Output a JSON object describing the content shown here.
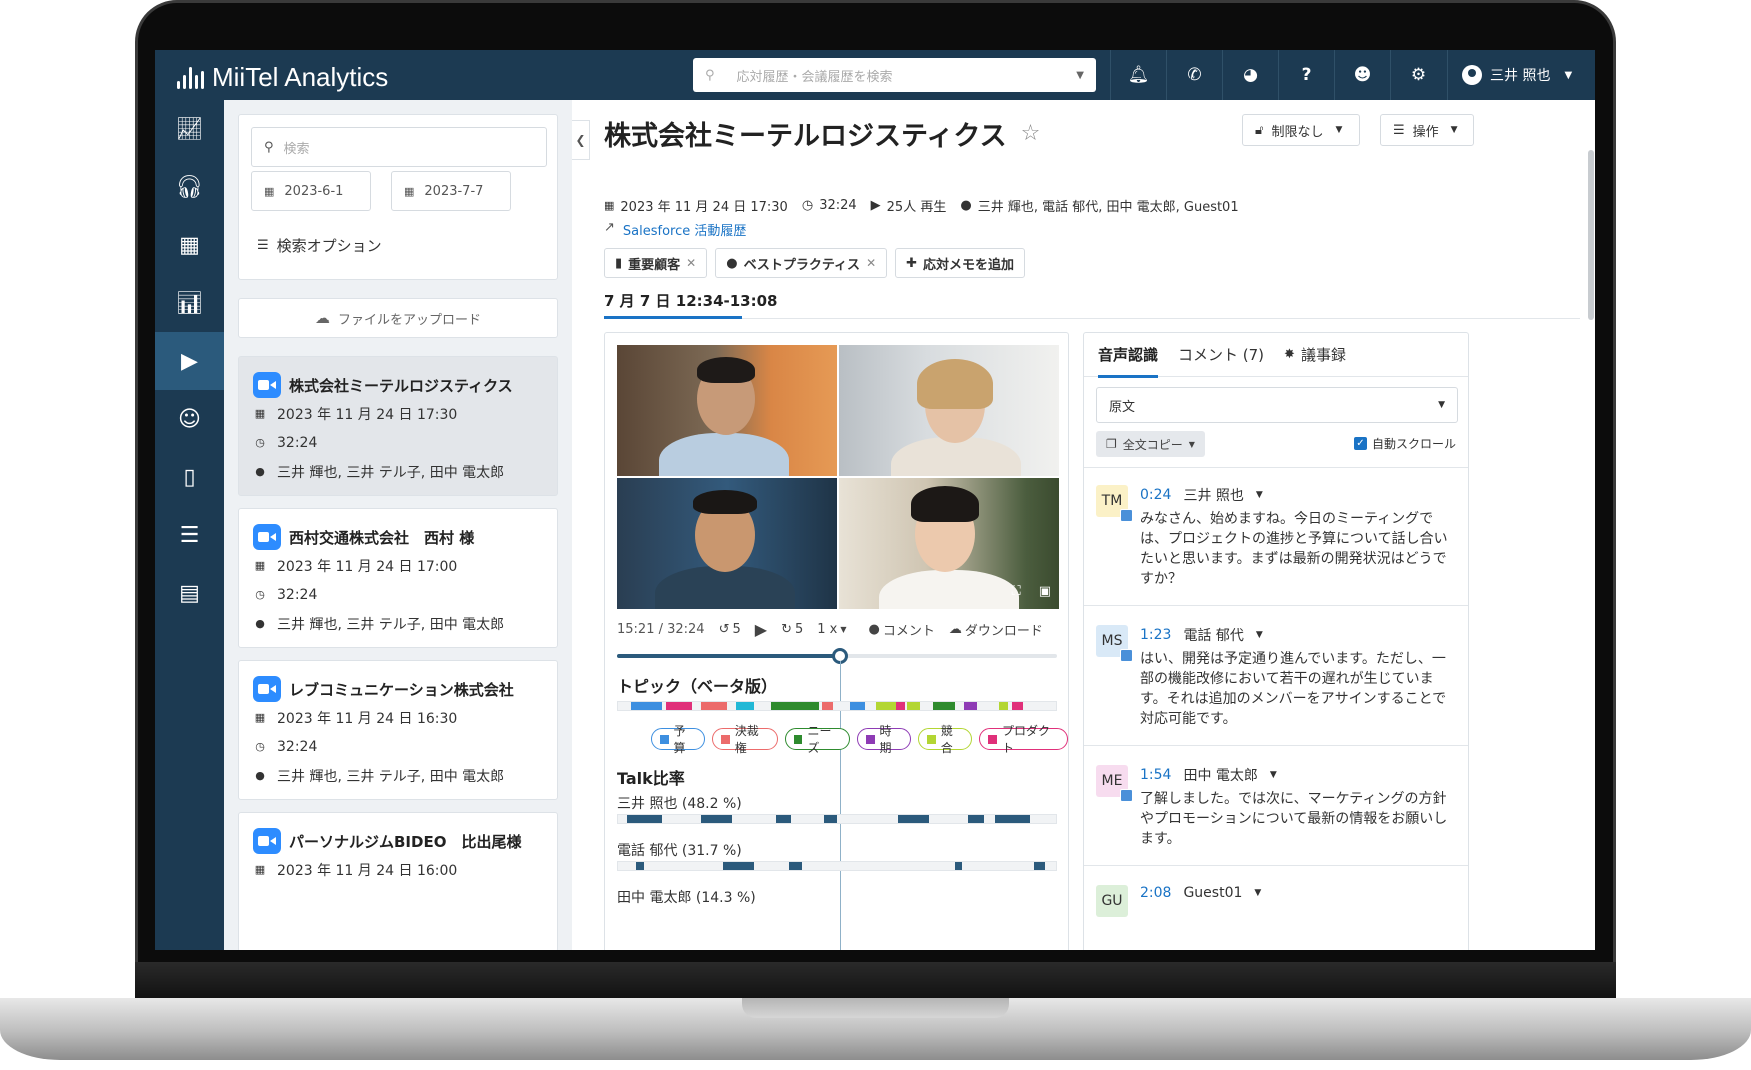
{
  "app": {
    "name": "MiiTel Analytics"
  },
  "topbar": {
    "search_placeholder": "応対履歴・会議履歴を検索",
    "user_name": "三井 照也",
    "icons": [
      "bell-icon",
      "phone-icon",
      "dashboard-icon",
      "help-icon",
      "support-icon",
      "settings-icon"
    ]
  },
  "rail": {
    "items": [
      "analytics-chart-icon",
      "headset-icon",
      "table-icon",
      "report-icon",
      "video-icon",
      "robot-icon",
      "contact-book-icon",
      "clipboard-icon",
      "document-icon"
    ],
    "active_index": 4
  },
  "filters": {
    "search_placeholder": "検索",
    "date_from": "2023-6-1",
    "date_sep": "-",
    "date_to": "2023-7-7",
    "options_label": "検索オプション",
    "upload_label": "ファイルをアップロード"
  },
  "records": [
    {
      "title": "株式会社ミーテルロジスティクス",
      "datetime": "2023 年 11 月 24 日 17:30",
      "duration": "32:24",
      "participants": "三井 輝也, 三井 テル子, 田中 電太郎",
      "selected": true
    },
    {
      "title": "西村交通株式会社　西村 様",
      "datetime": "2023 年 11 月 24 日 17:00",
      "duration": "32:24",
      "participants": "三井 輝也, 三井 テル子, 田中 電太郎",
      "selected": false
    },
    {
      "title": "レブコミュニケーション株式会社",
      "datetime": "2023 年 11 月 24 日 16:30",
      "duration": "32:24",
      "participants": "三井 輝也, 三井 テル子, 田中 電太郎",
      "selected": false
    },
    {
      "title": "パーソナルジムBIDEO　比出尾様",
      "datetime": "2023 年 11 月 24 日 16:00",
      "duration": "",
      "participants": "",
      "selected": false
    }
  ],
  "detail": {
    "title": "株式会社ミーテルロジスティクス",
    "restriction_label": "制限なし",
    "actions_label": "操作",
    "datetime": "2023 年 11 月 24 日 17:30",
    "duration": "32:24",
    "plays": "25人 再生",
    "participants": "三井 輝也, 電話 郁代, 田中 電太郎, Guest01",
    "salesforce_link": "Salesforce 活動履歴",
    "tags": [
      "重要顧客",
      "ベストプラクティス"
    ],
    "add_memo_label": "応対メモを追加",
    "date_tab": "7 月 7 日 12:34-13:08"
  },
  "player": {
    "time": "15:21 / 32:24",
    "rewind": "5",
    "forward": "5",
    "speed": "1 x",
    "comment_label": "コメント",
    "download_label": "ダウンロード",
    "progress_fraction": 0.506
  },
  "topics": {
    "title": "トピック（ベータ版）",
    "legend": [
      {
        "label": "予算",
        "color": "#3d8fe0",
        "border": "#3d8fe0"
      },
      {
        "label": "決裁権",
        "color": "#ec6b6b",
        "border": "#ec6b6b"
      },
      {
        "label": "ニーズ",
        "color": "#2e8b2e",
        "border": "#2e8b2e"
      },
      {
        "label": "時期",
        "color": "#8e3bb5",
        "border": "#8e3bb5"
      },
      {
        "label": "競合",
        "color": "#b3d633",
        "border": "#b3d633"
      },
      {
        "label": "プロダクト",
        "color": "#e0307a",
        "border": "#e0307a"
      }
    ],
    "segments": [
      {
        "start": 0.03,
        "end": 0.1,
        "color": "#3d8fe0"
      },
      {
        "start": 0.11,
        "end": 0.17,
        "color": "#e0307a"
      },
      {
        "start": 0.19,
        "end": 0.25,
        "color": "#ec6b6b"
      },
      {
        "start": 0.27,
        "end": 0.31,
        "color": "#22b8d6"
      },
      {
        "start": 0.35,
        "end": 0.46,
        "color": "#2e8b2e"
      },
      {
        "start": 0.465,
        "end": 0.49,
        "color": "#ec6b6b"
      },
      {
        "start": 0.53,
        "end": 0.565,
        "color": "#3d8fe0"
      },
      {
        "start": 0.59,
        "end": 0.635,
        "color": "#b3d633"
      },
      {
        "start": 0.635,
        "end": 0.655,
        "color": "#e0307a"
      },
      {
        "start": 0.66,
        "end": 0.69,
        "color": "#b3d633"
      },
      {
        "start": 0.72,
        "end": 0.77,
        "color": "#2e8b2e"
      },
      {
        "start": 0.79,
        "end": 0.82,
        "color": "#8e3bb5"
      },
      {
        "start": 0.87,
        "end": 0.89,
        "color": "#b3d633"
      },
      {
        "start": 0.9,
        "end": 0.925,
        "color": "#e0307a"
      }
    ]
  },
  "talk": {
    "title": "Talk比率",
    "speakers": [
      {
        "label": "三井 照也 (48.2 %)",
        "segments": [
          [
            0.02,
            0.1
          ],
          [
            0.19,
            0.26
          ],
          [
            0.36,
            0.395
          ],
          [
            0.47,
            0.5
          ],
          [
            0.64,
            0.71
          ],
          [
            0.8,
            0.835
          ],
          [
            0.86,
            0.94
          ]
        ]
      },
      {
        "label": "電話 郁代 (31.7 %)",
        "segments": [
          [
            0.04,
            0.06
          ],
          [
            0.24,
            0.31
          ],
          [
            0.39,
            0.42
          ],
          [
            0.77,
            0.785
          ],
          [
            0.95,
            0.975
          ]
        ]
      },
      {
        "label": "田中 電太郎 (14.3 %)",
        "segments": []
      }
    ]
  },
  "transcript": {
    "tabs": [
      "音声認識",
      "コメント (7)",
      "議事録"
    ],
    "language_option": "原文",
    "copy_label": "全文コピー",
    "autoscroll_label": "自動スクロール",
    "utterances": [
      {
        "initials": "TM",
        "badge_color": "#fbf1c7",
        "time": "0:24",
        "speaker": "三井 照也",
        "text": "みなさん、始めますね。今日のミーティングでは、プロジェクトの進捗と予算について話し合いたいと思います。まずは最新の開発状況はどうですか？"
      },
      {
        "initials": "MS",
        "badge_color": "#d9e9f7",
        "time": "1:23",
        "speaker": "電話 郁代",
        "text": "はい、開発は予定通り進んでいます。ただし、一部の機能改修において若干の遅れが生じています。それは追加のメンバーをアサインすることで対応可能です。"
      },
      {
        "initials": "ME",
        "badge_color": "#f7dcef",
        "time": "1:54",
        "speaker": "田中 電太郎",
        "text": "了解しました。では次に、マーケティングの方針やプロモーションについて最新の情報をお願いします。"
      },
      {
        "initials": "GU",
        "badge_color": "#dcefd9",
        "time": "2:08",
        "speaker": "Guest01",
        "text": ""
      }
    ]
  }
}
